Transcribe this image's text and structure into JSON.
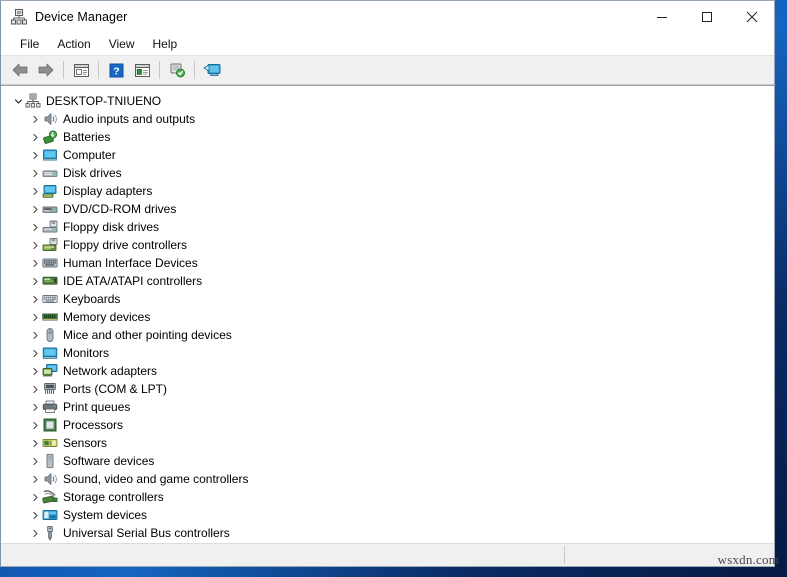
{
  "window": {
    "title": "Device Manager",
    "title_icon": "device-manager-icon",
    "controls": {
      "minimize": "minimize-button",
      "maximize": "maximize-button",
      "close": "close-button"
    }
  },
  "menubar": {
    "items": [
      {
        "label": "File",
        "name": "menu-file"
      },
      {
        "label": "Action",
        "name": "menu-action"
      },
      {
        "label": "View",
        "name": "menu-view"
      },
      {
        "label": "Help",
        "name": "menu-help"
      }
    ]
  },
  "toolbar": {
    "buttons": [
      {
        "name": "back-button",
        "icon": "back-arrow-icon"
      },
      {
        "name": "forward-button",
        "icon": "forward-arrow-icon"
      },
      {
        "name": "separator-1",
        "icon": "separator"
      },
      {
        "name": "properties-button",
        "icon": "properties-icon"
      },
      {
        "name": "separator-2",
        "icon": "separator"
      },
      {
        "name": "help-button",
        "icon": "help-question-icon"
      },
      {
        "name": "show-hidden-devices-button",
        "icon": "device-list-icon"
      },
      {
        "name": "separator-3",
        "icon": "separator"
      },
      {
        "name": "scan-for-hardware-changes-button",
        "icon": "scan-hardware-icon"
      },
      {
        "name": "separator-4",
        "icon": "separator"
      },
      {
        "name": "update-driver-button",
        "icon": "monitor-update-icon"
      }
    ]
  },
  "tree": {
    "root": {
      "label": "DESKTOP-TNIUENO",
      "expanded": true,
      "icon": "computer-root-icon"
    },
    "nodes": [
      {
        "label": "Audio inputs and outputs",
        "icon": "speaker-icon"
      },
      {
        "label": "Batteries",
        "icon": "battery-icon"
      },
      {
        "label": "Computer",
        "icon": "computer-icon"
      },
      {
        "label": "Disk drives",
        "icon": "disk-drive-icon"
      },
      {
        "label": "Display adapters",
        "icon": "display-adapter-icon"
      },
      {
        "label": "DVD/CD-ROM drives",
        "icon": "dvd-drive-icon"
      },
      {
        "label": "Floppy disk drives",
        "icon": "floppy-disk-icon"
      },
      {
        "label": "Floppy drive controllers",
        "icon": "floppy-controller-icon"
      },
      {
        "label": "Human Interface Devices",
        "icon": "hid-icon"
      },
      {
        "label": "IDE ATA/ATAPI controllers",
        "icon": "ide-controller-icon"
      },
      {
        "label": "Keyboards",
        "icon": "keyboard-icon"
      },
      {
        "label": "Memory devices",
        "icon": "memory-icon"
      },
      {
        "label": "Mice and other pointing devices",
        "icon": "mouse-icon"
      },
      {
        "label": "Monitors",
        "icon": "monitor-icon"
      },
      {
        "label": "Network adapters",
        "icon": "network-adapter-icon"
      },
      {
        "label": "Ports (COM & LPT)",
        "icon": "port-icon"
      },
      {
        "label": "Print queues",
        "icon": "printer-icon"
      },
      {
        "label": "Processors",
        "icon": "processor-icon"
      },
      {
        "label": "Sensors",
        "icon": "sensor-icon"
      },
      {
        "label": "Software devices",
        "icon": "software-device-icon"
      },
      {
        "label": "Sound, video and game controllers",
        "icon": "sound-controller-icon"
      },
      {
        "label": "Storage controllers",
        "icon": "storage-controller-icon"
      },
      {
        "label": "System devices",
        "icon": "system-device-icon"
      },
      {
        "label": "Universal Serial Bus controllers",
        "icon": "usb-controller-icon"
      }
    ]
  },
  "statusbar": {
    "text": ""
  },
  "watermark": {
    "text": "wsxdn.com"
  },
  "colors": {
    "window_bg": "#f0f0f0",
    "tree_bg": "#ffffff",
    "titlebar_bg": "#ffffff",
    "desktop_blue": "#0d47a1",
    "accent_blue": "#0078d7",
    "help_icon_blue": "#1569c7"
  }
}
